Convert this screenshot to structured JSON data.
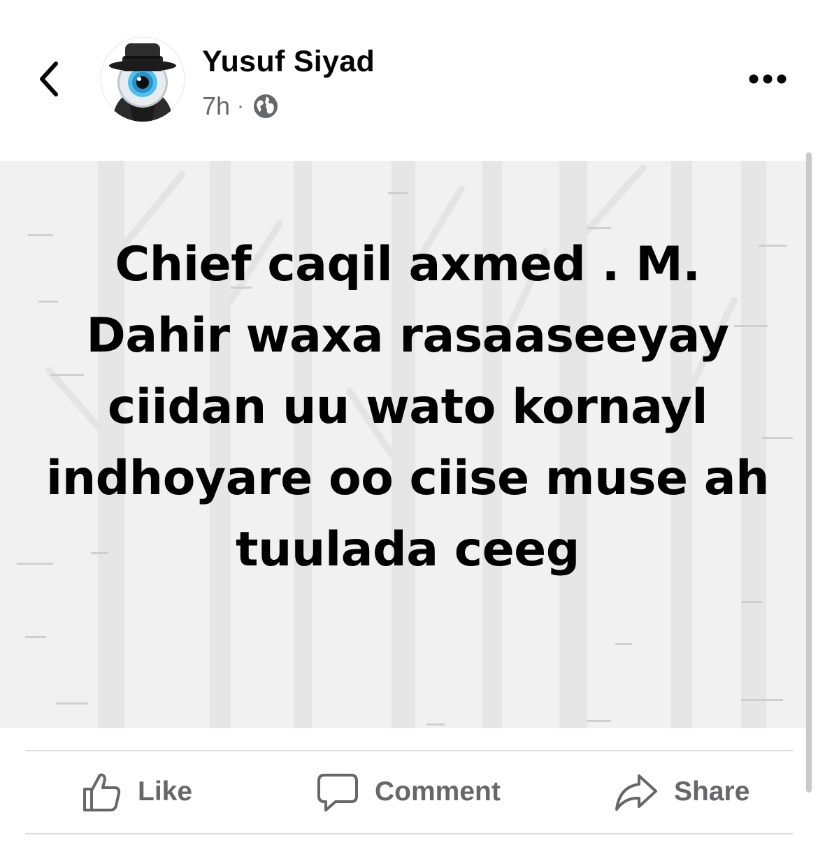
{
  "post": {
    "author": "Yusuf Siyad",
    "time": "7h",
    "separator": "·",
    "privacy_icon": "globe-icon",
    "text": "Chief caqil axmed . M. Dahir waxa rasaaseeyay ciidan uu wato kornayl indhoyare oo ciise muse ah tuulada ceeg",
    "background_color": "#f1f1f1"
  },
  "header": {
    "back_icon": "chevron-left-icon",
    "more_icon": "more-horizontal-icon"
  },
  "actions": {
    "like_label": "Like",
    "comment_label": "Comment",
    "share_label": "Share"
  },
  "colors": {
    "secondary_text": "#65676b",
    "divider": "#dadde1"
  }
}
